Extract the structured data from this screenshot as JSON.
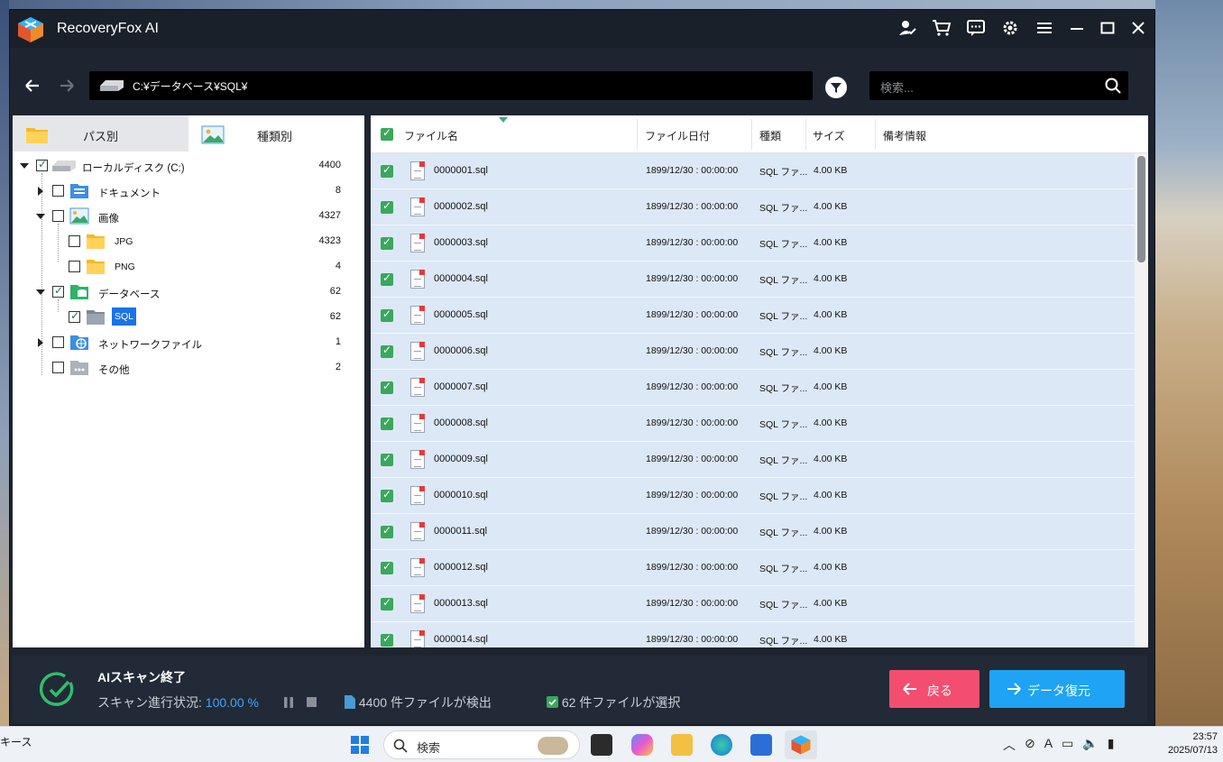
{
  "app": {
    "title": "RecoveryFox AI"
  },
  "toolbar": {
    "path": "C:¥データベース¥SQL¥",
    "search_placeholder": "検索..."
  },
  "tabs": [
    {
      "label": "パス別"
    },
    {
      "label": "種類別"
    }
  ],
  "tree": [
    {
      "label": "ローカルディスク (C:)",
      "count": "4400"
    },
    {
      "label": "ドキュメント",
      "count": "8"
    },
    {
      "label": "画像",
      "count": "4327"
    },
    {
      "label": "JPG",
      "count": "4323"
    },
    {
      "label": "PNG",
      "count": "4"
    },
    {
      "label": "データベース",
      "count": "62"
    },
    {
      "label": "SQL",
      "count": "62"
    },
    {
      "label": "ネットワークファイル",
      "count": "1"
    },
    {
      "label": "その他",
      "count": "2"
    }
  ],
  "table": {
    "headers": [
      "ファイル名",
      "ファイル日付",
      "種類",
      "サイズ",
      "備考情報"
    ],
    "rows": [
      {
        "name": "0000001.sql",
        "date": "1899/12/30 : 00:00:00",
        "type": "SQL ファ...",
        "size": "4.00 KB"
      },
      {
        "name": "0000002.sql",
        "date": "1899/12/30 : 00:00:00",
        "type": "SQL ファ...",
        "size": "4.00 KB"
      },
      {
        "name": "0000003.sql",
        "date": "1899/12/30 : 00:00:00",
        "type": "SQL ファ...",
        "size": "4.00 KB"
      },
      {
        "name": "0000004.sql",
        "date": "1899/12/30 : 00:00:00",
        "type": "SQL ファ...",
        "size": "4.00 KB"
      },
      {
        "name": "0000005.sql",
        "date": "1899/12/30 : 00:00:00",
        "type": "SQL ファ...",
        "size": "4.00 KB"
      },
      {
        "name": "0000006.sql",
        "date": "1899/12/30 : 00:00:00",
        "type": "SQL ファ...",
        "size": "4.00 KB"
      },
      {
        "name": "0000007.sql",
        "date": "1899/12/30 : 00:00:00",
        "type": "SQL ファ...",
        "size": "4.00 KB"
      },
      {
        "name": "0000008.sql",
        "date": "1899/12/30 : 00:00:00",
        "type": "SQL ファ...",
        "size": "4.00 KB"
      },
      {
        "name": "0000009.sql",
        "date": "1899/12/30 : 00:00:00",
        "type": "SQL ファ...",
        "size": "4.00 KB"
      },
      {
        "name": "0000010.sql",
        "date": "1899/12/30 : 00:00:00",
        "type": "SQL ファ...",
        "size": "4.00 KB"
      },
      {
        "name": "0000011.sql",
        "date": "1899/12/30 : 00:00:00",
        "type": "SQL ファ...",
        "size": "4.00 KB"
      },
      {
        "name": "0000012.sql",
        "date": "1899/12/30 : 00:00:00",
        "type": "SQL ファ...",
        "size": "4.00 KB"
      },
      {
        "name": "0000013.sql",
        "date": "1899/12/30 : 00:00:00",
        "type": "SQL ファ...",
        "size": "4.00 KB"
      },
      {
        "name": "0000014.sql",
        "date": "1899/12/30 : 00:00:00",
        "type": "SQL ファ...",
        "size": "4.00 KB"
      }
    ]
  },
  "status": {
    "title": "AIスキャン終了",
    "progress_label": "スキャン進行状況:",
    "progress_value": "100.00 %",
    "found_count": "4400",
    "found_suffix": "件ファイルが検出",
    "selected_count": "62",
    "selected_suffix": "件ファイルが選択",
    "back_label": "戻る",
    "recover_label": "データ復元"
  },
  "taskbar": {
    "left_text": "キース",
    "search_placeholder": "検索",
    "time": "23:57",
    "date": "2025/07/13"
  },
  "colors": {
    "accent_blue": "#1fa3f4",
    "back_pink": "#f34e70",
    "check_green": "#39a85a",
    "row_selected": "#dce8f6"
  }
}
